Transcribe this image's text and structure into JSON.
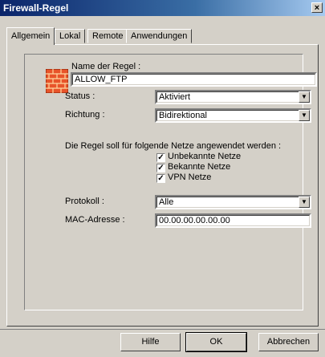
{
  "window": {
    "title": "Firewall-Regel",
    "close": "×"
  },
  "tabs": [
    {
      "label": "Allgemein"
    },
    {
      "label": "Lokal"
    },
    {
      "label": "Remote"
    },
    {
      "label": "Anwendungen"
    }
  ],
  "form": {
    "name_label": "Name der Regel :",
    "name_value": "ALLOW_FTP",
    "status_label": "Status :",
    "status_value": "Aktiviert",
    "direction_label": "Richtung :",
    "direction_value": "Bidirektional",
    "networks_label": "Die Regel soll für folgende Netze angewendet werden :",
    "networks": [
      {
        "label": "Unbekannte Netze",
        "checked": true
      },
      {
        "label": "Bekannte Netze",
        "checked": true
      },
      {
        "label": "VPN Netze",
        "checked": true
      }
    ],
    "protocol_label": "Protokoll :",
    "protocol_value": "Alle",
    "mac_label": "MAC-Adresse :",
    "mac_value": "00.00.00.00.00.00"
  },
  "buttons": {
    "help": "Hilfe",
    "ok": "OK",
    "cancel": "Abbrechen"
  },
  "icons": {
    "rule": "brick-wall-icon",
    "dropdown": "chevron-down-icon",
    "check": "checkmark-icon"
  }
}
